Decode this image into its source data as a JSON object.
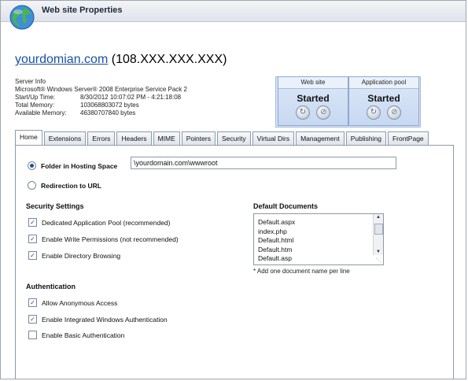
{
  "window": {
    "title": "Web site Properties"
  },
  "heading": {
    "domain": "yourdomian.com",
    "ip": "(108.XXX.XXX.XXX)"
  },
  "server_info": {
    "label": "Server Info",
    "os": "Microsoft® Windows Server® 2008 Enterprise Service Pack 2",
    "rows": [
      {
        "key": "Start/Up Time:",
        "value": "8/30/2012 10:07:02 PM - 4:21:18:08"
      },
      {
        "key": "Total Memory:",
        "value": "103068803072 bytes"
      },
      {
        "key": "Available Memory:",
        "value": "46380707840 bytes"
      }
    ]
  },
  "status": {
    "web_site": {
      "caption": "Web site",
      "state": "Started"
    },
    "app_pool": {
      "caption": "Application pool",
      "state": "Started"
    }
  },
  "tabs": [
    "Home",
    "Extensions",
    "Errors",
    "Headers",
    "MIME",
    "Pointers",
    "Security",
    "Virtual Dirs",
    "Management",
    "Publishing",
    "FrontPage"
  ],
  "home": {
    "folder_label": "Folder in Hosting Space",
    "folder_value": "\\yourdomain.com\\wwwroot",
    "redirect_label": "Redirection to URL",
    "security_title": "Security Settings",
    "security_options": [
      {
        "label": "Dedicated Application Pool (recommended)",
        "checked": true
      },
      {
        "label": "Enable Write Permissions (not recommended)",
        "checked": true
      },
      {
        "label": "Enable Directory Browsing",
        "checked": true
      }
    ],
    "auth_title": "Authentication",
    "auth_options": [
      {
        "label": "Allow Anonymous Access",
        "checked": true
      },
      {
        "label": "Enable Integrated Windows Authentication",
        "checked": true
      },
      {
        "label": "Enable Basic Authentication",
        "checked": false
      }
    ],
    "default_docs_title": "Default Documents",
    "default_docs": [
      "Default.aspx",
      "index.php",
      "Default.html",
      "Default.htm",
      "Default.asp"
    ],
    "default_docs_note": "* Add one document name per line"
  },
  "colors": {
    "accent": "#1e4f9e",
    "status_bg": "#c7d8f1",
    "link": "#1a4fa3"
  }
}
